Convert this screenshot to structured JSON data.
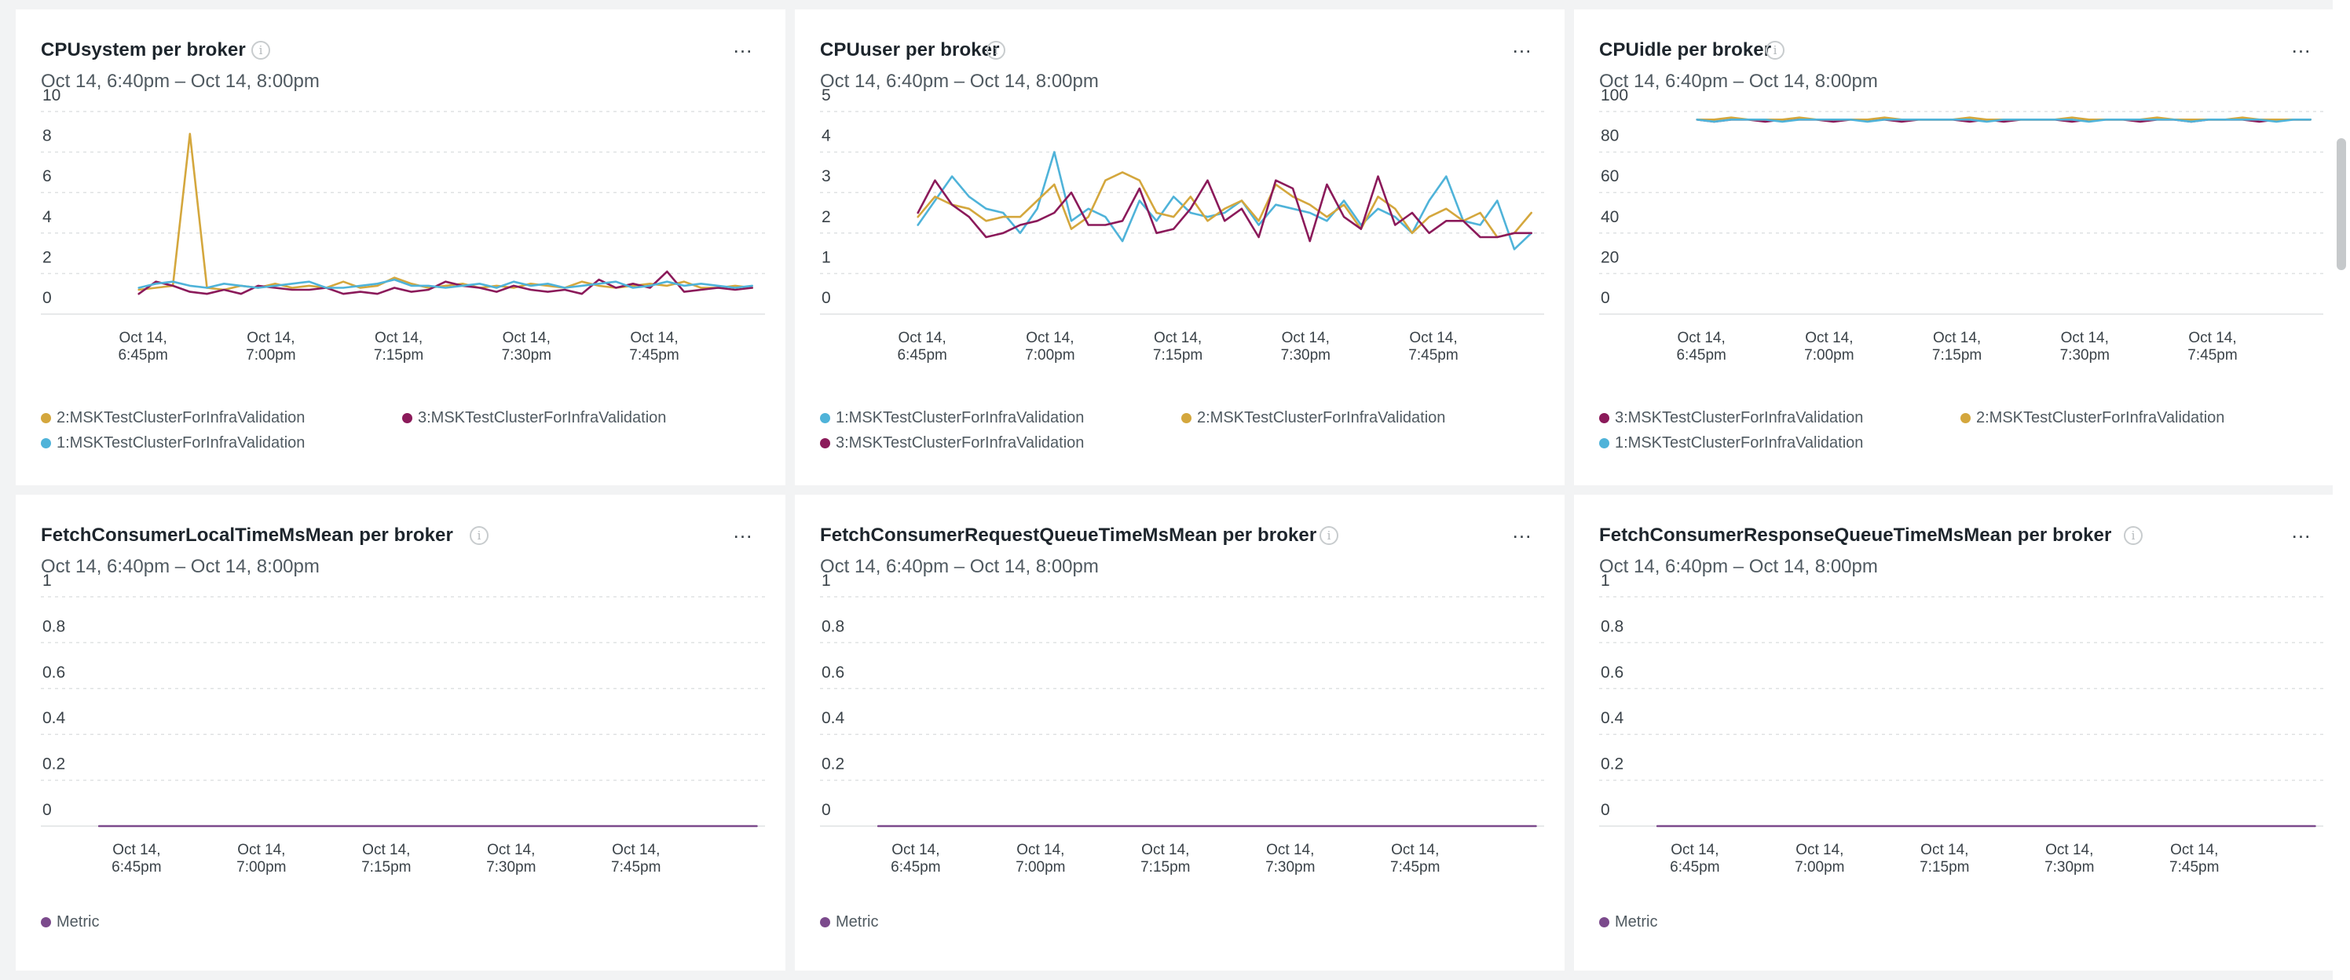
{
  "colors": {
    "gold": "#d4a73d",
    "magenta": "#8b1a5a",
    "blue": "#4fb3d9",
    "metric": "#7b4a8c",
    "grid": "#dfe2e3"
  },
  "icons": {
    "info": "info-icon",
    "menu": "more-options-icon"
  },
  "info_glyph": "i",
  "menu_glyph": "...",
  "panels": [
    {
      "title": "CPUsystem per broker",
      "subtitle": "Oct 14, 6:40pm – Oct 14, 8:00pm",
      "legend": [
        {
          "label": "2:MSKTestClusterForInfraValidation",
          "color": "#d4a73d"
        },
        {
          "label": "3:MSKTestClusterForInfraValidation",
          "color": "#8b1a5a"
        },
        {
          "label": "1:MSKTestClusterForInfraValidation",
          "color": "#4fb3d9"
        }
      ]
    },
    {
      "title": "CPUuser per broker",
      "subtitle": "Oct 14, 6:40pm – Oct 14, 8:00pm",
      "legend": [
        {
          "label": "1:MSKTestClusterForInfraValidation",
          "color": "#4fb3d9"
        },
        {
          "label": "2:MSKTestClusterForInfraValidation",
          "color": "#d4a73d"
        },
        {
          "label": "3:MSKTestClusterForInfraValidation",
          "color": "#8b1a5a"
        }
      ]
    },
    {
      "title": "CPUidle per broker",
      "subtitle": "Oct 14, 6:40pm – Oct 14, 8:00pm",
      "legend": [
        {
          "label": "3:MSKTestClusterForInfraValidation",
          "color": "#8b1a5a"
        },
        {
          "label": "2:MSKTestClusterForInfraValidation",
          "color": "#d4a73d"
        },
        {
          "label": "1:MSKTestClusterForInfraValidation",
          "color": "#4fb3d9"
        }
      ]
    },
    {
      "title": "FetchConsumerLocalTimeMsMean per broker",
      "subtitle": "Oct 14, 6:40pm – Oct 14, 8:00pm",
      "legend": [
        {
          "label": "Metric",
          "color": "#7b4a8c"
        }
      ]
    },
    {
      "title": "FetchConsumerRequestQueueTimeMsMean per broker",
      "subtitle": "Oct 14, 6:40pm – Oct 14, 8:00pm",
      "legend": [
        {
          "label": "Metric",
          "color": "#7b4a8c"
        }
      ]
    },
    {
      "title": "FetchConsumerResponseQueueTimeMsMean per broker",
      "subtitle": "Oct 14, 6:40pm – Oct 14, 8:00pm",
      "legend": [
        {
          "label": "Metric",
          "color": "#7b4a8c"
        }
      ]
    }
  ],
  "chart_data": [
    {
      "type": "line",
      "title": "CPUsystem per broker",
      "subtitle": "Oct 14, 6:40pm – Oct 14, 8:00pm",
      "ylim": [
        0,
        10
      ],
      "yticks": [
        "0",
        "2",
        "4",
        "6",
        "8",
        "10"
      ],
      "xticks": [
        {
          "line1": "Oct 14,",
          "line2": "6:45pm",
          "t": 5
        },
        {
          "line1": "Oct 14,",
          "line2": "7:00pm",
          "t": 20
        },
        {
          "line1": "Oct 14,",
          "line2": "7:15pm",
          "t": 35
        },
        {
          "line1": "Oct 14,",
          "line2": "7:30pm",
          "t": 50
        },
        {
          "line1": "Oct 14,",
          "line2": "7:45pm",
          "t": 65
        }
      ],
      "xlim": [
        -7,
        78
      ],
      "x_start": 4.5,
      "x_step": 2,
      "grid": true,
      "legend_position": "bottom",
      "series": [
        {
          "name": "2:MSKTestClusterForInfraValidation",
          "color": "#d4a73d",
          "values": [
            1.2,
            1.3,
            1.4,
            8.9,
            1.3,
            1.2,
            1.4,
            1.3,
            1.5,
            1.3,
            1.4,
            1.3,
            1.6,
            1.3,
            1.4,
            1.8,
            1.5,
            1.3,
            1.4,
            1.5,
            1.3,
            1.4,
            1.3,
            1.5,
            1.4,
            1.3,
            1.6,
            1.4,
            1.3,
            1.4,
            1.5,
            1.4,
            1.6,
            1.3,
            1.3,
            1.4,
            1.3
          ]
        },
        {
          "name": "3:MSKTestClusterForInfraValidation",
          "color": "#8b1a5a",
          "values": [
            1.0,
            1.6,
            1.4,
            1.1,
            1.0,
            1.2,
            1.0,
            1.4,
            1.3,
            1.2,
            1.2,
            1.3,
            1.0,
            1.1,
            1.0,
            1.3,
            1.1,
            1.2,
            1.6,
            1.4,
            1.3,
            1.1,
            1.4,
            1.2,
            1.1,
            1.2,
            1.0,
            1.7,
            1.3,
            1.5,
            1.3,
            2.1,
            1.1,
            1.2,
            1.3,
            1.2,
            1.3
          ]
        },
        {
          "name": "1:MSKTestClusterForInfraValidation",
          "color": "#4fb3d9",
          "values": [
            1.3,
            1.5,
            1.6,
            1.4,
            1.3,
            1.5,
            1.4,
            1.3,
            1.4,
            1.5,
            1.6,
            1.3,
            1.3,
            1.4,
            1.5,
            1.7,
            1.4,
            1.4,
            1.3,
            1.4,
            1.5,
            1.3,
            1.6,
            1.4,
            1.5,
            1.3,
            1.4,
            1.5,
            1.6,
            1.3,
            1.4,
            1.6,
            1.4,
            1.5,
            1.4,
            1.3,
            1.4
          ]
        }
      ]
    },
    {
      "type": "line",
      "title": "CPUuser per broker",
      "subtitle": "Oct 14, 6:40pm – Oct 14, 8:00pm",
      "ylim": [
        0,
        5
      ],
      "yticks": [
        "0",
        "1",
        "2",
        "3",
        "4",
        "5"
      ],
      "xticks": [
        {
          "line1": "Oct 14,",
          "line2": "6:45pm",
          "t": 5
        },
        {
          "line1": "Oct 14,",
          "line2": "7:00pm",
          "t": 20
        },
        {
          "line1": "Oct 14,",
          "line2": "7:15pm",
          "t": 35
        },
        {
          "line1": "Oct 14,",
          "line2": "7:30pm",
          "t": 50
        },
        {
          "line1": "Oct 14,",
          "line2": "7:45pm",
          "t": 65
        }
      ],
      "xlim": [
        -7,
        78
      ],
      "x_start": 4.5,
      "x_step": 2,
      "grid": true,
      "legend_position": "bottom",
      "series": [
        {
          "name": "1:MSKTestClusterForInfraValidation",
          "color": "#4fb3d9",
          "values": [
            2.2,
            2.8,
            3.4,
            2.9,
            2.6,
            2.5,
            2.0,
            2.6,
            4.0,
            2.3,
            2.6,
            2.4,
            1.8,
            2.8,
            2.3,
            2.9,
            2.5,
            2.4,
            2.5,
            2.8,
            2.2,
            2.7,
            2.6,
            2.5,
            2.3,
            2.8,
            2.2,
            2.6,
            2.4,
            2.0,
            2.8,
            3.4,
            2.3,
            2.2,
            2.8,
            1.6,
            2.0
          ]
        },
        {
          "name": "2:MSKTestClusterForInfraValidation",
          "color": "#d4a73d",
          "values": [
            2.4,
            2.9,
            2.7,
            2.6,
            2.3,
            2.4,
            2.4,
            2.8,
            3.2,
            2.1,
            2.4,
            3.3,
            3.5,
            3.3,
            2.5,
            2.4,
            2.9,
            2.3,
            2.6,
            2.8,
            2.3,
            3.2,
            2.9,
            2.7,
            2.4,
            2.7,
            2.1,
            2.9,
            2.6,
            2.0,
            2.4,
            2.6,
            2.3,
            2.5,
            1.9,
            2.0,
            2.5
          ]
        },
        {
          "name": "3:MSKTestClusterForInfraValidation",
          "color": "#8b1a5a",
          "values": [
            2.5,
            3.3,
            2.7,
            2.4,
            1.9,
            2.0,
            2.2,
            2.3,
            2.5,
            3.0,
            2.2,
            2.2,
            2.3,
            3.1,
            2.0,
            2.1,
            2.6,
            3.3,
            2.3,
            2.6,
            1.9,
            3.3,
            3.1,
            1.8,
            3.2,
            2.4,
            2.1,
            3.4,
            2.2,
            2.5,
            2.0,
            2.3,
            2.3,
            1.9,
            1.9,
            2.0,
            2.0
          ]
        }
      ]
    },
    {
      "type": "line",
      "title": "CPUidle per broker",
      "subtitle": "Oct 14, 6:40pm – Oct 14, 8:00pm",
      "ylim": [
        0,
        100
      ],
      "yticks": [
        "0",
        "20",
        "40",
        "60",
        "80",
        "100"
      ],
      "xticks": [
        {
          "line1": "Oct 14,",
          "line2": "6:45pm",
          "t": 5
        },
        {
          "line1": "Oct 14,",
          "line2": "7:00pm",
          "t": 20
        },
        {
          "line1": "Oct 14,",
          "line2": "7:15pm",
          "t": 35
        },
        {
          "line1": "Oct 14,",
          "line2": "7:30pm",
          "t": 50
        },
        {
          "line1": "Oct 14,",
          "line2": "7:45pm",
          "t": 65
        }
      ],
      "xlim": [
        -7,
        78
      ],
      "x_start": 4.5,
      "x_step": 2,
      "grid": true,
      "legend_position": "bottom",
      "series": [
        {
          "name": "3:MSKTestClusterForInfraValidation",
          "color": "#8b1a5a",
          "values": [
            96,
            95,
            96,
            96,
            95,
            96,
            96,
            96,
            95,
            96,
            96,
            96,
            95,
            96,
            96,
            96,
            95,
            96,
            95,
            96,
            96,
            96,
            95,
            96,
            96,
            96,
            95,
            96,
            96,
            95,
            96,
            96,
            96,
            95,
            96,
            96,
            96
          ]
        },
        {
          "name": "2:MSKTestClusterForInfraValidation",
          "color": "#d4a73d",
          "values": [
            96,
            96,
            97,
            96,
            96,
            96,
            97,
            96,
            96,
            96,
            96,
            97,
            96,
            96,
            96,
            96,
            97,
            96,
            96,
            96,
            96,
            96,
            97,
            96,
            96,
            96,
            96,
            97,
            96,
            96,
            96,
            96,
            97,
            96,
            96,
            96,
            96
          ]
        },
        {
          "name": "1:MSKTestClusterForInfraValidation",
          "color": "#4fb3d9",
          "values": [
            96,
            95,
            96,
            96,
            96,
            95,
            96,
            96,
            96,
            96,
            95,
            96,
            96,
            96,
            96,
            96,
            96,
            95,
            96,
            96,
            96,
            96,
            96,
            95,
            96,
            96,
            96,
            96,
            96,
            95,
            96,
            96,
            96,
            96,
            95,
            96,
            96
          ]
        }
      ]
    },
    {
      "type": "line",
      "title": "FetchConsumerLocalTimeMsMean per broker",
      "subtitle": "Oct 14, 6:40pm – Oct 14, 8:00pm",
      "ylim": [
        0,
        1
      ],
      "yticks": [
        "0",
        "0.2",
        "0.4",
        "0.6",
        "0.8",
        "1"
      ],
      "xticks": [
        {
          "line1": "Oct 14,",
          "line2": "6:45pm",
          "t": 5
        },
        {
          "line1": "Oct 14,",
          "line2": "7:00pm",
          "t": 20
        },
        {
          "line1": "Oct 14,",
          "line2": "7:15pm",
          "t": 35
        },
        {
          "line1": "Oct 14,",
          "line2": "7:30pm",
          "t": 50
        },
        {
          "line1": "Oct 14,",
          "line2": "7:45pm",
          "t": 65
        }
      ],
      "xlim": [
        -6.5,
        80.5
      ],
      "x_start": 0.5,
      "x_step": 79,
      "grid": true,
      "legend_position": "bottom",
      "series": [
        {
          "name": "Metric",
          "color": "#7b4a8c",
          "values": [
            0,
            0
          ]
        }
      ]
    },
    {
      "type": "line",
      "title": "FetchConsumerRequestQueueTimeMsMean per broker",
      "subtitle": "Oct 14, 6:40pm – Oct 14, 8:00pm",
      "ylim": [
        0,
        1
      ],
      "yticks": [
        "0",
        "0.2",
        "0.4",
        "0.6",
        "0.8",
        "1"
      ],
      "xticks": [
        {
          "line1": "Oct 14,",
          "line2": "6:45pm",
          "t": 5
        },
        {
          "line1": "Oct 14,",
          "line2": "7:00pm",
          "t": 20
        },
        {
          "line1": "Oct 14,",
          "line2": "7:15pm",
          "t": 35
        },
        {
          "line1": "Oct 14,",
          "line2": "7:30pm",
          "t": 50
        },
        {
          "line1": "Oct 14,",
          "line2": "7:45pm",
          "t": 65
        }
      ],
      "xlim": [
        -6.5,
        80.5
      ],
      "x_start": 0.5,
      "x_step": 79,
      "grid": true,
      "legend_position": "bottom",
      "series": [
        {
          "name": "Metric",
          "color": "#7b4a8c",
          "values": [
            0,
            0
          ]
        }
      ]
    },
    {
      "type": "line",
      "title": "FetchConsumerResponseQueueTimeMsMean per broker",
      "subtitle": "Oct 14, 6:40pm – Oct 14, 8:00pm",
      "ylim": [
        0,
        1
      ],
      "yticks": [
        "0",
        "0.2",
        "0.4",
        "0.6",
        "0.8",
        "1"
      ],
      "xticks": [
        {
          "line1": "Oct 14,",
          "line2": "6:45pm",
          "t": 5
        },
        {
          "line1": "Oct 14,",
          "line2": "7:00pm",
          "t": 20
        },
        {
          "line1": "Oct 14,",
          "line2": "7:15pm",
          "t": 35
        },
        {
          "line1": "Oct 14,",
          "line2": "7:30pm",
          "t": 50
        },
        {
          "line1": "Oct 14,",
          "line2": "7:45pm",
          "t": 65
        }
      ],
      "xlim": [
        -6.5,
        80.5
      ],
      "x_start": 0.5,
      "x_step": 79,
      "grid": true,
      "legend_position": "bottom",
      "series": [
        {
          "name": "Metric",
          "color": "#7b4a8c",
          "values": [
            0,
            0
          ]
        }
      ]
    }
  ]
}
